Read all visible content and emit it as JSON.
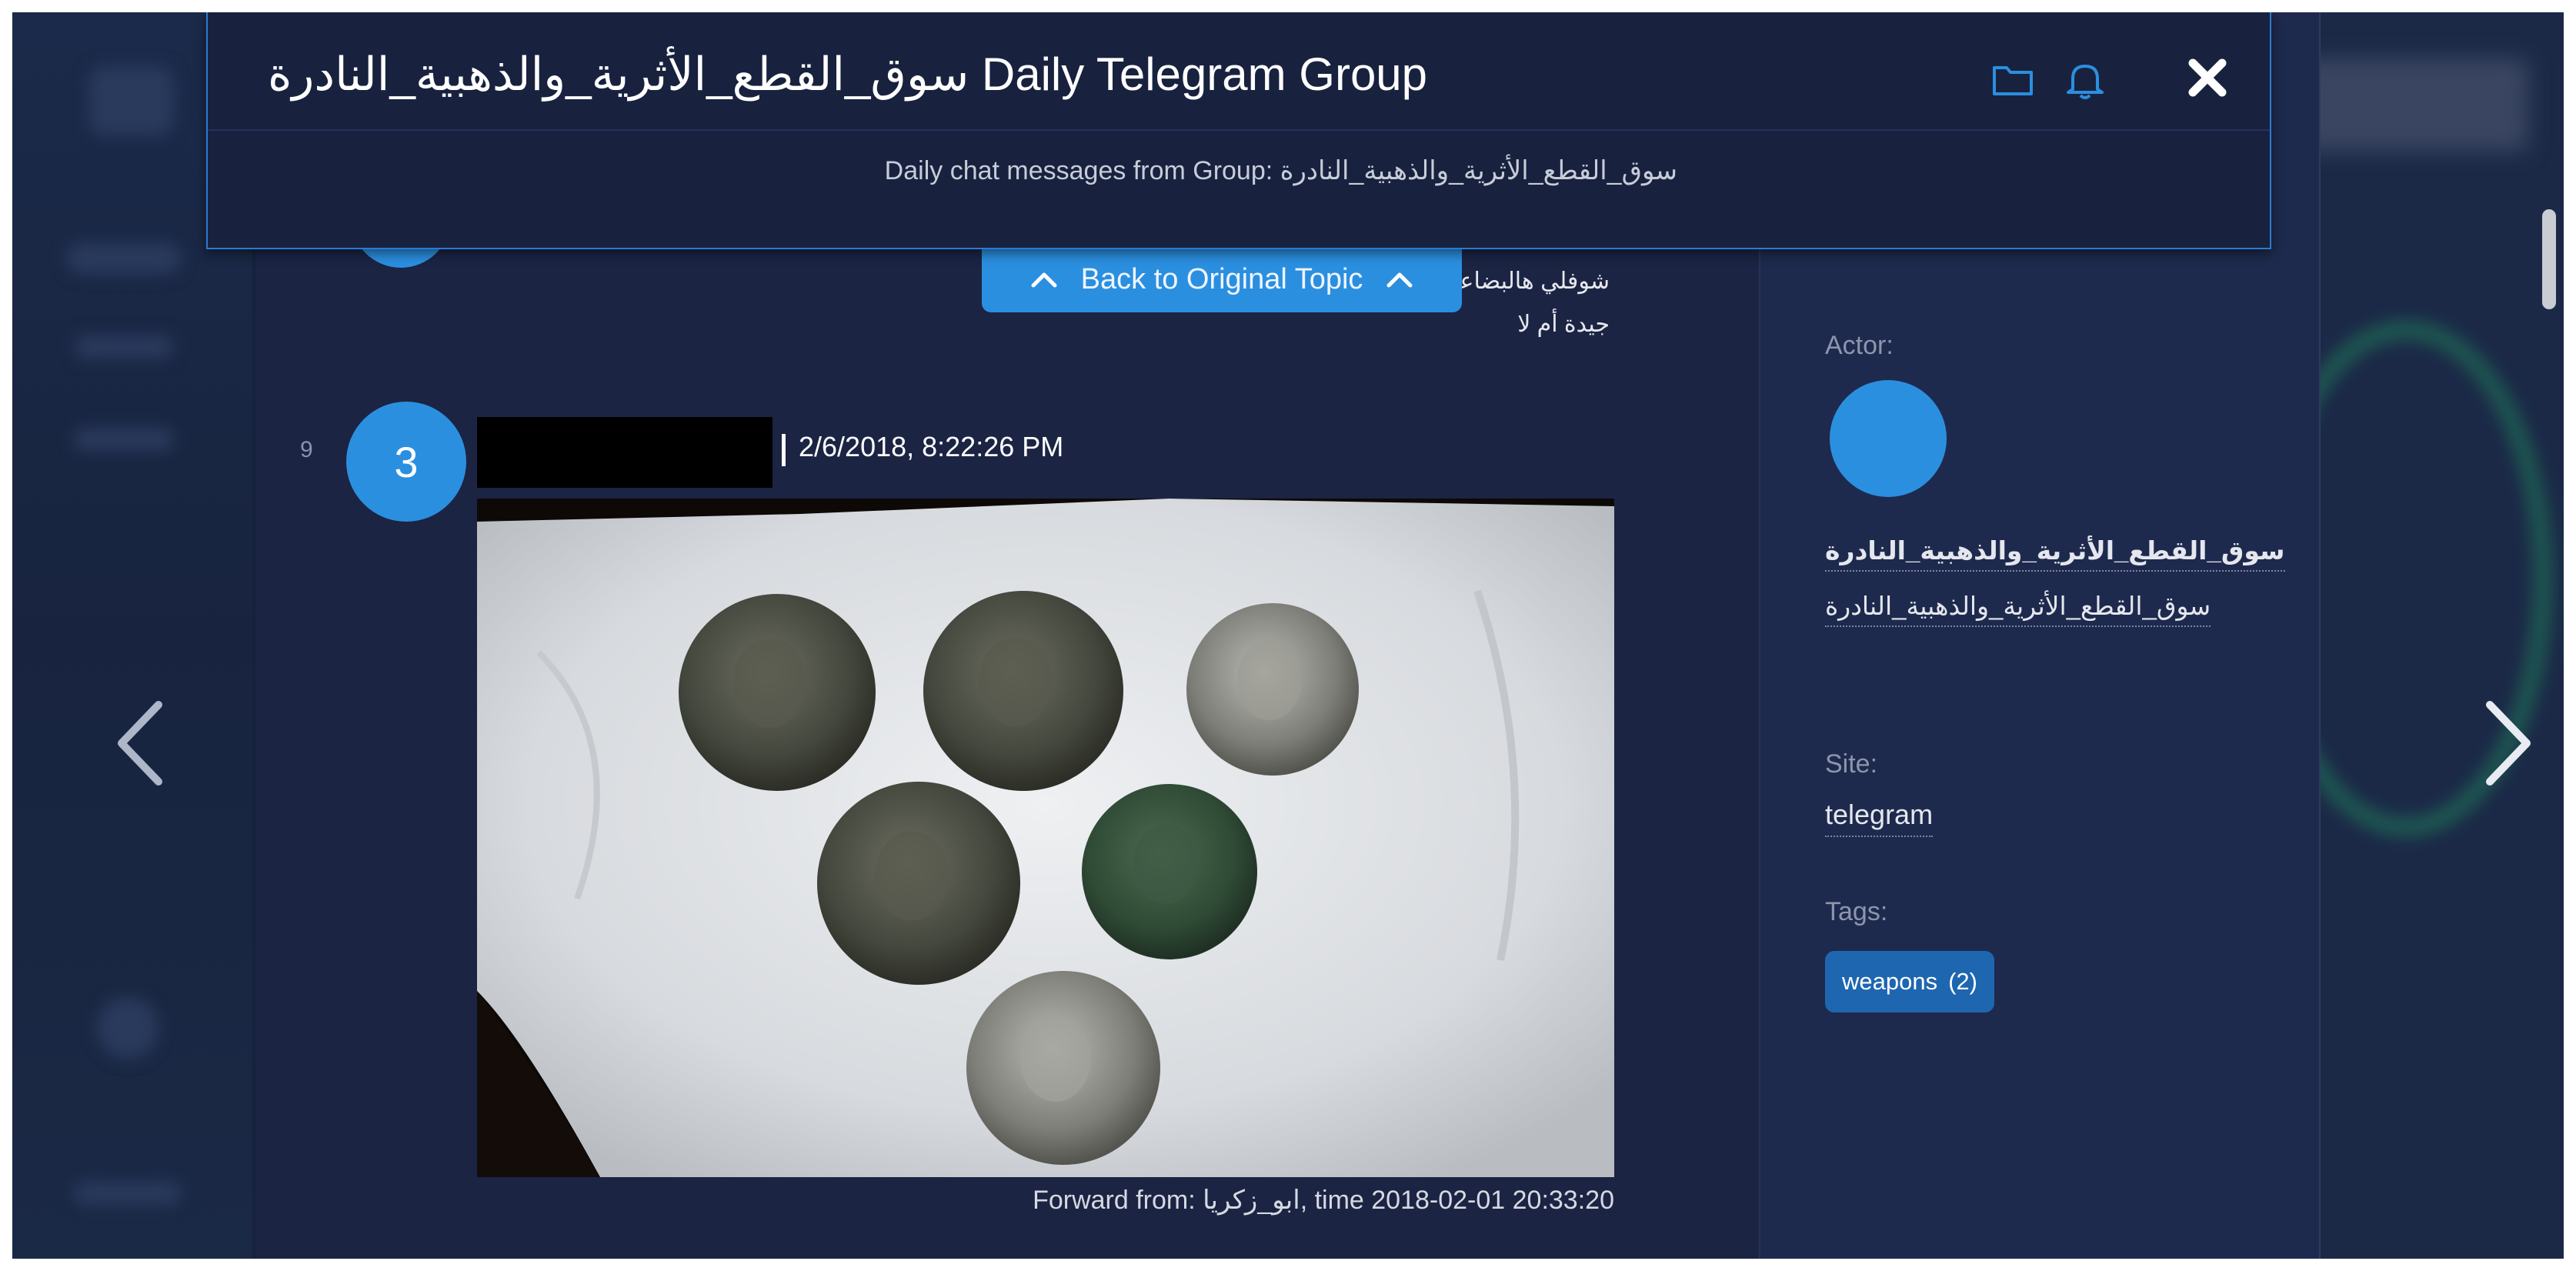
{
  "header": {
    "title": "سوق_القطع_الأثرية_والذهبية_النادرة Daily Telegram Group",
    "subtitle": "Daily chat messages from Group: سوق_القطع_الأثرية_والذهبية_النادرة",
    "icons": [
      "folder-icon",
      "bell-icon",
      "close-icon"
    ]
  },
  "back_button": {
    "label": "Back to Original Topic"
  },
  "previous_message": {
    "line1": "شوفلي هالبضاعة",
    "line2": "جيدة أم لا"
  },
  "message": {
    "index": "9",
    "avatar_label": "3",
    "timestamp": "2/6/2018, 8:22:26 PM",
    "forward_text": "Forward from: ابو_زكريا, time 2018-02-01 20:33:20"
  },
  "sidebar": {
    "actor_label": "Actor:",
    "actor_name": "سوق_القطع_الأثرية_والذهبية_النادرة",
    "actor_handle": "سوق_القطع_الأثرية_والذهبية_النادرة",
    "site_label": "Site:",
    "site_value": "telegram",
    "tags_label": "Tags:",
    "tag_name": "weapons",
    "tag_count": "(2)"
  },
  "colors": {
    "accent": "#2b8fe0",
    "panel": "#1b2443",
    "header_border": "#2b7bd0",
    "tag": "#1e66b0"
  }
}
